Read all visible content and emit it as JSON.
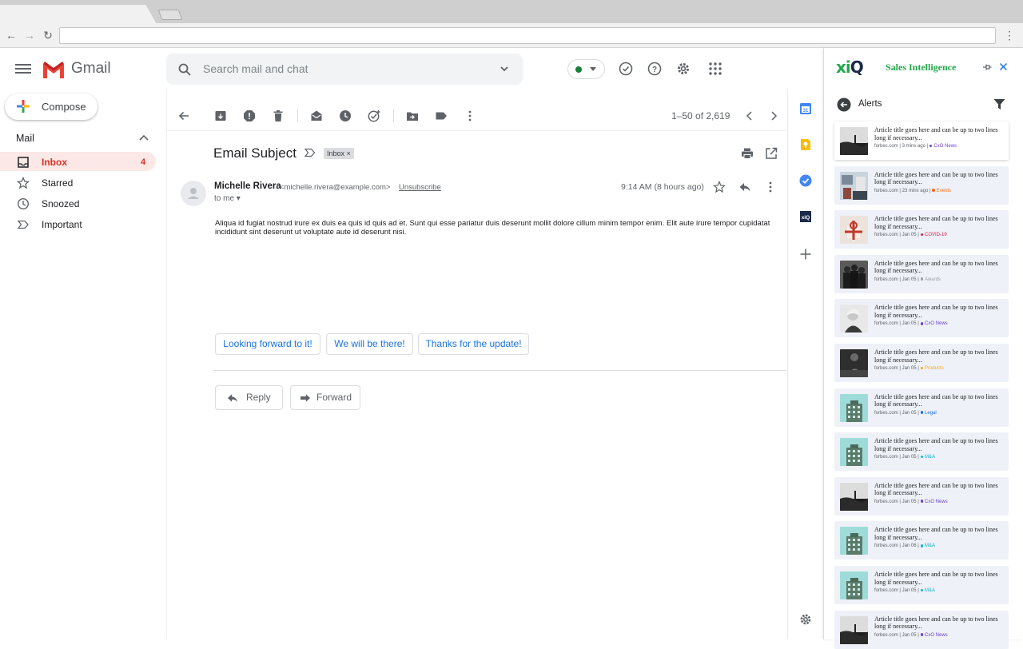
{
  "app": {
    "name": "Gmail"
  },
  "search": {
    "placeholder": "Search mail and chat"
  },
  "sidebar": {
    "compose_label": "Compose",
    "section_label": "Mail",
    "items": [
      {
        "label": "Inbox",
        "icon": "inbox-icon",
        "count": "4",
        "active": true
      },
      {
        "label": "Starred",
        "icon": "star-icon",
        "active": false
      },
      {
        "label": "Snoozed",
        "icon": "clock-icon",
        "active": false
      },
      {
        "label": "Important",
        "icon": "important-icon",
        "active": false
      }
    ]
  },
  "toolbar": {
    "pager": "1–50 of 2,619"
  },
  "email": {
    "subject": "Email Subject",
    "label_chip": "Inbox ×",
    "sender_name": "Michelle Rivera",
    "sender_email": "<michelle.rivera@example.com>",
    "unsubscribe": "Unsubscribe",
    "to": "to me ▾",
    "time": "9:14 AM (8 hours ago)",
    "body": "Aliqua id fugiat nostrud irure ex duis ea quis id quis ad et. Sunt qui esse pariatur duis deserunt mollit dolore cillum minim tempor enim. Elit aute irure tempor cupidatat incididunt sint deserunt ut voluptate aute id deserunt nisi.",
    "smart_replies": [
      "Looking forward to it!",
      "We will be there!",
      "Thanks for the update!"
    ],
    "reply_label": "Reply",
    "forward_label": "Forward"
  },
  "panel": {
    "logo": "xiQ",
    "title": "Sales Intelligence",
    "section": "Alerts",
    "cards": [
      {
        "title": "Article title goes here and can be up to two lines long if necessary...",
        "source": "forbes.com",
        "time": "3 mins ago",
        "tag": "CxO News",
        "tag_color": "#6b3fd6",
        "thumb": "dark"
      },
      {
        "title": "Article title goes here and can be up to two lines long if necessary...",
        "source": "forbes.com",
        "time": "23 mins ago",
        "tag": "Events",
        "tag_color": "#f5701f",
        "thumb": "office"
      },
      {
        "title": "Article title goes here and can be up to two lines long if necessary...",
        "source": "forbes.com",
        "time": "Jan 05",
        "tag": "COVID-19",
        "tag_color": "#e01e4d",
        "thumb": "gift"
      },
      {
        "title": "Article title goes here and can be up to two lines long if necessary...",
        "source": "forbes.com",
        "time": "Jan 05",
        "tag": "Awards",
        "tag_color": "#9aa0a6",
        "thumb": "people"
      },
      {
        "title": "Article title goes here and can be up to two lines long if necessary...",
        "source": "forbes.com",
        "time": "Jan 05",
        "tag": "CxO News",
        "tag_color": "#6b3fd6",
        "thumb": "portrait"
      },
      {
        "title": "Article title goes here and can be up to two lines long if necessary...",
        "source": "forbes.com",
        "time": "Jan 05",
        "tag": "Products",
        "tag_color": "#f5a623",
        "thumb": "desk"
      },
      {
        "title": "Article title goes here and can be up to two lines long if necessary...",
        "source": "forbes.com",
        "time": "Jan 05",
        "tag": "Legal",
        "tag_color": "#1a73e8",
        "thumb": "building"
      },
      {
        "title": "Article title goes here and can be up to two lines long if necessary...",
        "source": "forbes.com",
        "time": "Jan 05",
        "tag": "M&A",
        "tag_color": "#12b5cb",
        "thumb": "building"
      },
      {
        "title": "Article title goes here and can be up to two lines long if necessary...",
        "source": "forbes.com",
        "time": "Jan 05",
        "tag": "CxO News",
        "tag_color": "#6b3fd6",
        "thumb": "dark"
      },
      {
        "title": "Article title goes here and can be up to two lines long if necessary...",
        "source": "forbes.com",
        "time": "Jan 06",
        "tag": "M&A",
        "tag_color": "#12b5cb",
        "thumb": "building"
      },
      {
        "title": "Article title goes here and can be up to two lines long if necessary...",
        "source": "forbes.com",
        "time": "Jan 05",
        "tag": "M&A",
        "tag_color": "#12b5cb",
        "thumb": "building"
      },
      {
        "title": "Article title goes here and can be up to two lines long if necessary...",
        "source": "forbes.com",
        "time": "Jan 05",
        "tag": "CxO News",
        "tag_color": "#6b3fd6",
        "thumb": "dark"
      }
    ]
  },
  "colors": {
    "gmail_red": "#d93025",
    "xiq_green": "#22a94b",
    "link_blue": "#1a73e8"
  }
}
